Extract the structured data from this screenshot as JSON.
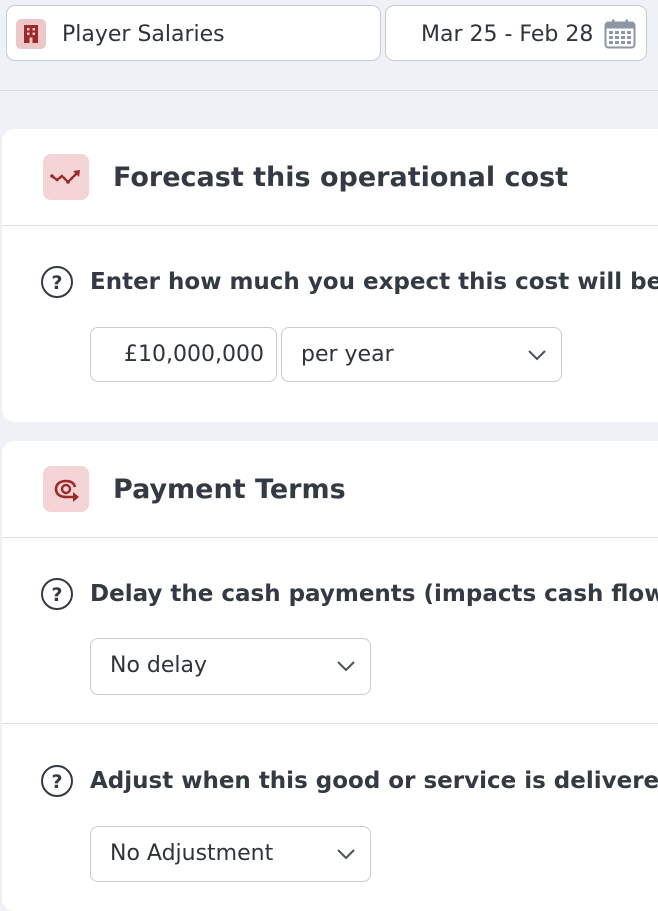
{
  "header": {
    "cost_name": "Player Salaries",
    "date_range": "Mar 25 - Feb 28",
    "cost_icon": "building-icon",
    "date_icon": "calendar-icon"
  },
  "forecast": {
    "title": "Forecast this operational cost",
    "icon": "trend-up-icon",
    "question": "Enter how much you expect this cost will be",
    "amount": "£10,000,000",
    "period": "per year"
  },
  "payment_terms": {
    "title": "Payment Terms",
    "icon": "payment-delay-icon",
    "delay_question": "Delay the cash payments (impacts cash flow)",
    "delay_value": "No delay",
    "adjust_question": "Adjust when this good or service is delivered (impa",
    "adjust_value": "No Adjustment"
  },
  "colors": {
    "accent": "#9c2a2a",
    "icon_bg": "#f4d4d4",
    "page_bg": "#eef1f5"
  }
}
